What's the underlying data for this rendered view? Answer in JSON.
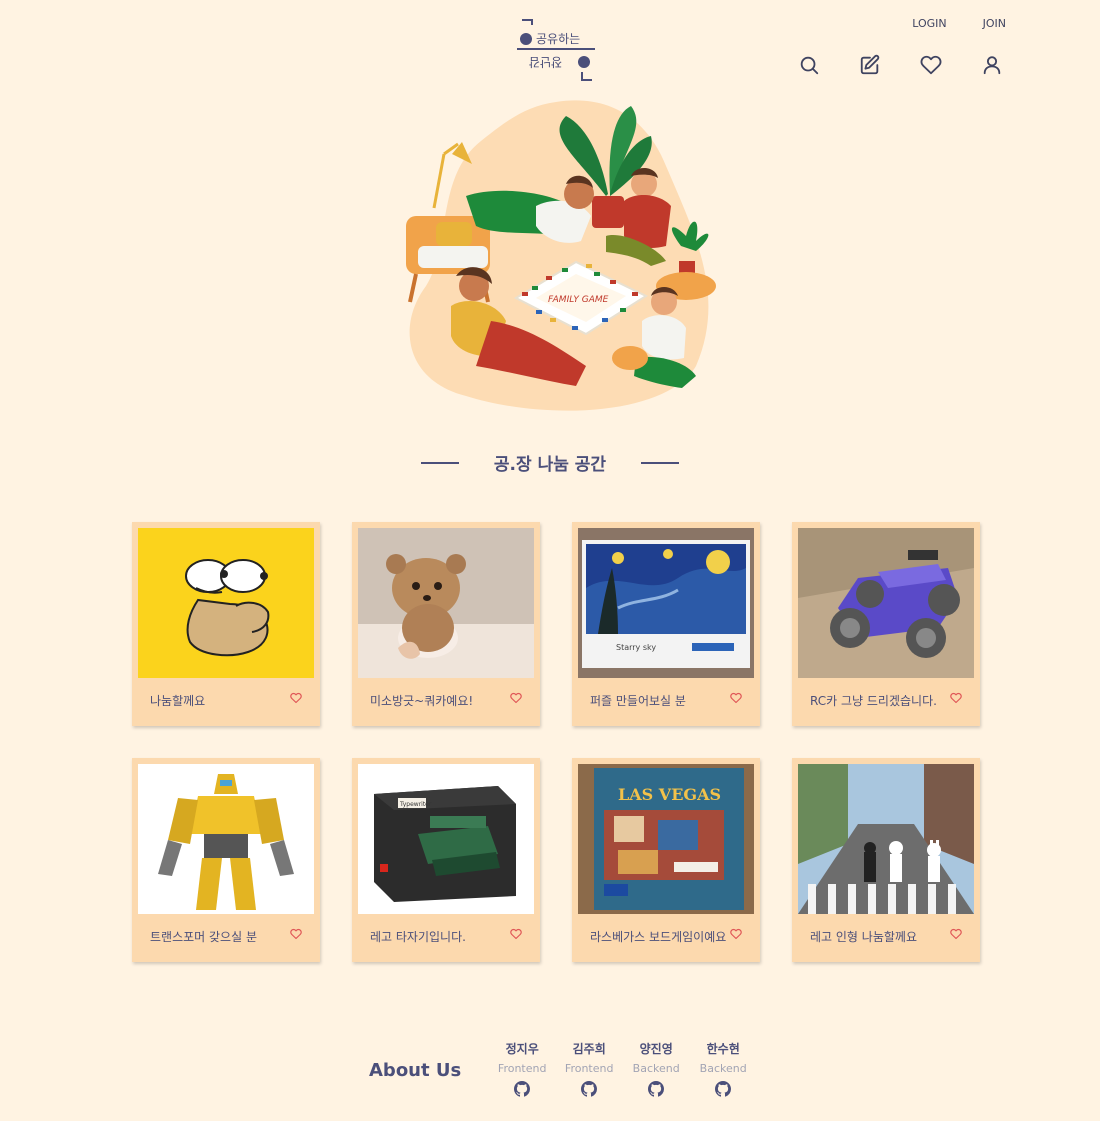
{
  "nav": {
    "login": "LOGIN",
    "join": "JOIN"
  },
  "logo": {
    "line1": "공유하는",
    "line2": "장난감"
  },
  "icons": [
    "search-icon",
    "pencil-square-icon",
    "heart-icon",
    "user-icon"
  ],
  "hero": {
    "board_text": "FAMILY GAME"
  },
  "section": {
    "title": "공.장 나눔 공간"
  },
  "cards": [
    {
      "title": "나눔할께요",
      "image": "cartoon-character"
    },
    {
      "title": "미소방긋~쿼카예요!",
      "image": "plush-quokka"
    },
    {
      "title": "퍼즐 만들어보실 분",
      "image": "starry-night-puzzle"
    },
    {
      "title": "RC카 그냥 드리겠습니다.",
      "image": "rc-car"
    },
    {
      "title": "트랜스포머 갖으실 분",
      "image": "transformer-figure"
    },
    {
      "title": "레고 타자기입니다.",
      "image": "lego-typewriter"
    },
    {
      "title": "라스베가스 보드게임이예요",
      "image": "las-vegas-boardgame"
    },
    {
      "title": "레고 인형 나눔할께요",
      "image": "lego-figures"
    }
  ],
  "puzzle_box": {
    "label": "Starry sky"
  },
  "typewriter_box": {
    "label": "Typewriter"
  },
  "boardgame_box": {
    "label": "LAS VEGAS"
  },
  "about": {
    "title": "About Us",
    "members": [
      {
        "name": "정지우",
        "role": "Frontend"
      },
      {
        "name": "김주희",
        "role": "Frontend"
      },
      {
        "name": "양진영",
        "role": "Backend"
      },
      {
        "name": "한수현",
        "role": "Backend"
      }
    ]
  },
  "colors": {
    "background": "#fff3e2",
    "card": "#fcd9ae",
    "text": "#4b4f7a",
    "heart": "#e05757"
  }
}
